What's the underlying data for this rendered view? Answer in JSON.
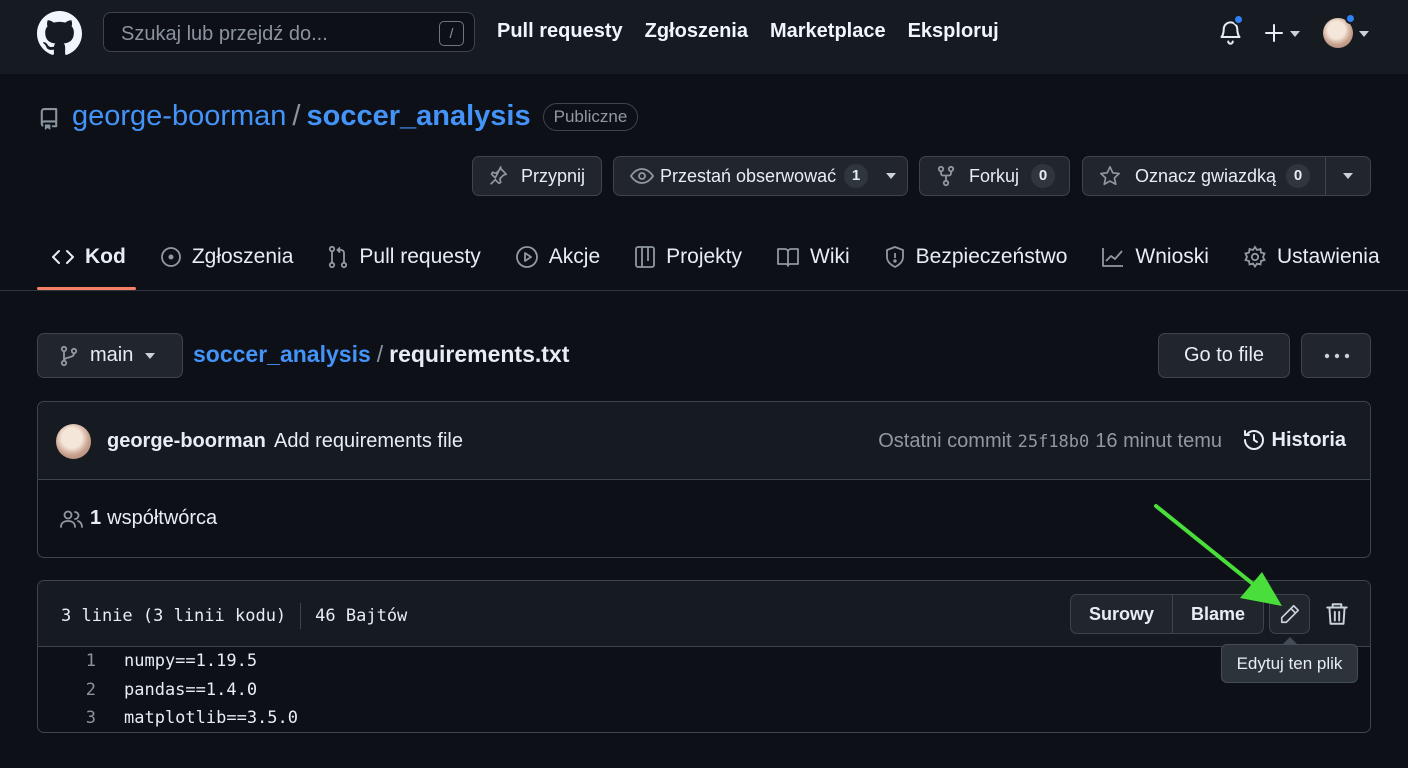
{
  "header": {
    "search_placeholder": "Szukaj lub przejdź do...",
    "search_shortcut": "/",
    "nav": [
      "Pull requesty",
      "Zgłoszenia",
      "Marketplace",
      "Eksploruj"
    ]
  },
  "repo": {
    "owner": "george-boorman",
    "separator": "/",
    "name": "soccer_analysis",
    "visibility": "Publiczne",
    "pin_label": "Przypnij",
    "watch_label": "Przestań obserwować",
    "watch_count": "1",
    "fork_label": "Forkuj",
    "fork_count": "0",
    "star_label": "Oznacz gwiazdką",
    "star_count": "0"
  },
  "tabs": [
    {
      "label": "Kod",
      "icon": "code-icon",
      "active": true
    },
    {
      "label": "Zgłoszenia",
      "icon": "issue-icon"
    },
    {
      "label": "Pull requesty",
      "icon": "pull-request-icon"
    },
    {
      "label": "Akcje",
      "icon": "play-icon"
    },
    {
      "label": "Projekty",
      "icon": "table-icon"
    },
    {
      "label": "Wiki",
      "icon": "book-icon"
    },
    {
      "label": "Bezpieczeństwo",
      "icon": "shield-icon"
    },
    {
      "label": "Wnioski",
      "icon": "graph-icon"
    },
    {
      "label": "Ustawienia",
      "icon": "gear-icon"
    }
  ],
  "file_nav": {
    "branch": "main",
    "path_repo": "soccer_analysis",
    "path_sep": "/",
    "path_file": "requirements.txt",
    "go_to_file": "Go to file",
    "more": "···"
  },
  "commit": {
    "author": "george-boorman",
    "message": "Add requirements file",
    "last_commit_label": "Ostatni commit",
    "sha": "25f18b0",
    "time": "16 minut temu",
    "history_label": "Historia",
    "contributors_count": "1",
    "contributors_label": "współtwórca"
  },
  "file": {
    "lines_info": "3 linie (3 linii kodu)",
    "size": "46 Bajtów",
    "raw_label": "Surowy",
    "blame_label": "Blame",
    "edit_tooltip": "Edytuj ten plik",
    "lines": [
      {
        "num": "1",
        "text": "numpy==1.19.5"
      },
      {
        "num": "2",
        "text": "pandas==1.4.0"
      },
      {
        "num": "3",
        "text": "matplotlib==3.5.0"
      }
    ]
  },
  "colors": {
    "accent_link": "#4493f8",
    "tab_underline": "#f78166",
    "annotation_arrow": "#4ade3a",
    "notification_dot": "#2f81f7"
  }
}
